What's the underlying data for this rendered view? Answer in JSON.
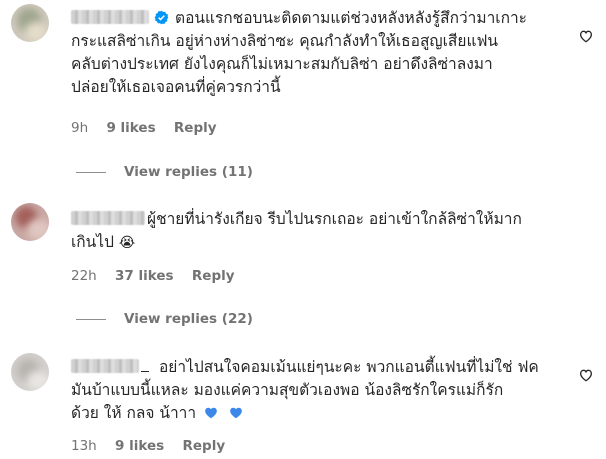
{
  "comments": [
    {
      "username_masked": "████_██",
      "text_line1": "ตอนแรกชอบนะติดตามแต่ช่วงหลังหลังรู้สึกว่ามาเกาะ",
      "text_line2": "กระแสลิซ่าเกิน อยู่ห่างห่างลิซ่าซะ คุณกำลังทำให้เธอสูญเสียแฟน",
      "text_line3": "คลับต่างประเทศ ยังไงคุณก็ไม่เหมาะสมกับลิซ่า อย่าดึงลิซ่าลงมา",
      "text_line4": "ปล่อยให้เธอเจอคนที่คู่ควรกว่านี้",
      "time": "9h",
      "likes": "9 likes",
      "reply": "Reply",
      "view_replies": "View replies (11)",
      "verified": true
    },
    {
      "username_masked": "██████",
      "text_line1": "ผู้ชายที่น่ารังเกียจ รีบไปนรกเถอะ อย่าเข้าใกล้ลิซ่าให้มาก",
      "text_line2": "เกินไป",
      "emoji": "😭",
      "time": "22h",
      "likes": "37 likes",
      "reply": "Reply",
      "view_replies": "View replies (22)"
    },
    {
      "username_masked": "██████_",
      "text_line1": "อย่าไปสนใจคอมเม้นแย่ๆนะคะ พวกแอนตี้แฟนที่ไม่ใช่ ฟค",
      "text_line2": "มันบ้าแบบนี้แหละ มองแค่ความสุขตัวเองพอ น้องลิซรักใครแม่ก็รัก",
      "text_line3": "ด้วย ให้ กลจ น้าาา",
      "time": "13h",
      "likes": "9 likes",
      "reply": "Reply"
    }
  ],
  "colors": {
    "text": "#262626",
    "meta": "#737373",
    "verified_blue": "#0095f6",
    "heart_blue": "#3b88e8"
  },
  "icons": [
    "verified-badge-icon",
    "heart-icon",
    "crying-face-emoji",
    "blue-heart-icon"
  ]
}
